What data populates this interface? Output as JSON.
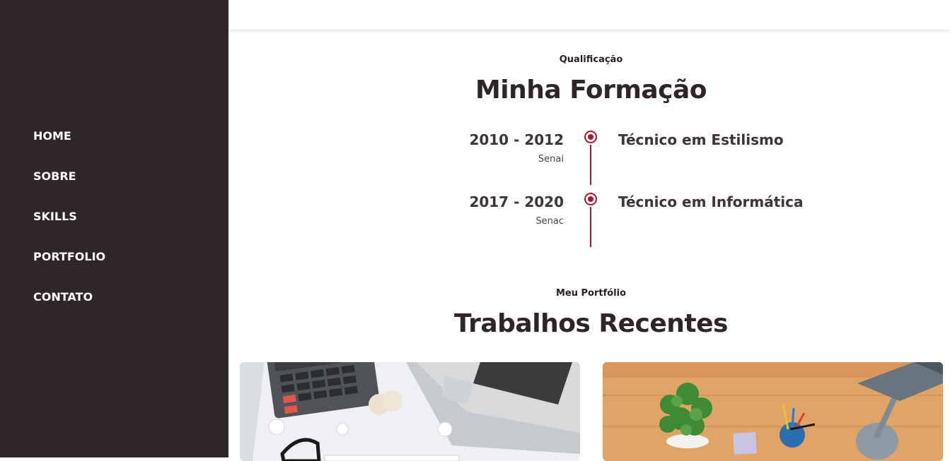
{
  "nav": {
    "items": [
      {
        "label": "HOME"
      },
      {
        "label": "SOBRE"
      },
      {
        "label": "SKILLS"
      },
      {
        "label": "PORTFOLIO"
      },
      {
        "label": "CONTATO"
      }
    ]
  },
  "qualification": {
    "subtitle": "Qualificação",
    "title": "Minha Formação",
    "items": [
      {
        "years": "2010 - 2012",
        "school": "Senai",
        "course": "Técnico em Estilismo"
      },
      {
        "years": "2017 - 2020",
        "school": "Senac",
        "course": "Técnico em Informática"
      }
    ]
  },
  "portfolio": {
    "subtitle": "Meu Portfólio",
    "title": "Trabalhos Recentes",
    "cards": [
      {
        "image": "desk-calculator-laptop-photo"
      },
      {
        "image": "wooden-desk-plant-lamp-photo"
      }
    ]
  },
  "colors": {
    "sidebar": "#2f2627",
    "accent": "#b5122f",
    "heading": "#2e2526"
  }
}
